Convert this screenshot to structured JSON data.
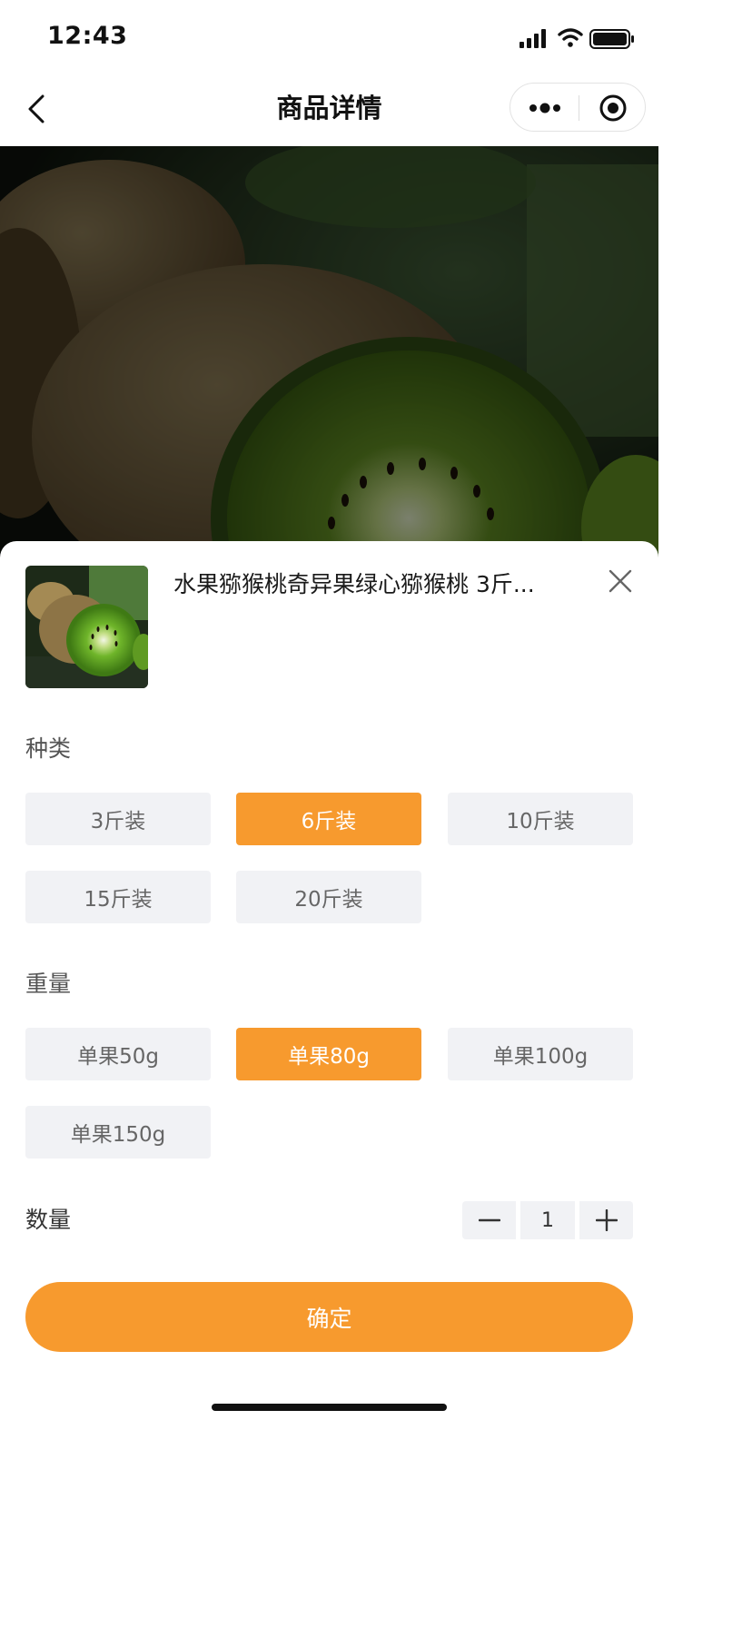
{
  "status_bar": {
    "time": "12:43",
    "icons": [
      "signal-icon",
      "wifi-icon",
      "battery-icon"
    ]
  },
  "nav": {
    "title": "商品详情",
    "back_icon": "chevron-left-icon",
    "capsule_icons": [
      "more-dots-icon",
      "target-close-icon"
    ]
  },
  "hero": {
    "image": "kiwi-fruit-photo"
  },
  "sheet": {
    "thumbnail": "kiwi-thumbnail-photo",
    "product_title": "水果猕猴桃奇异果绿心猕猴桃 3斤...",
    "close_icon": "close-icon",
    "category": {
      "label": "种类",
      "options": [
        "3斤装",
        "6斤装",
        "10斤装",
        "15斤装",
        "20斤装"
      ],
      "selected": "6斤装"
    },
    "weight": {
      "label": "重量",
      "options": [
        "单果50g",
        "单果80g",
        "单果100g",
        "单果150g"
      ],
      "selected": "单果80g"
    },
    "quantity": {
      "label": "数量",
      "value": "1",
      "minus_icon": "minus-icon",
      "plus_icon": "plus-icon"
    },
    "confirm_label": "确定"
  },
  "colors": {
    "accent": "#f79a2e",
    "option_bg": "#f1f2f5",
    "option_text": "#666666"
  }
}
